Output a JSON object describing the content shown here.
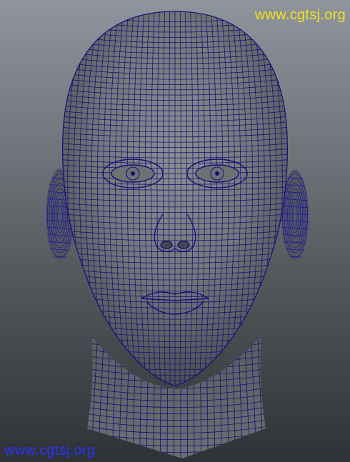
{
  "viewport": {
    "watermark_top": "www.cgtsj.org",
    "watermark_bottom": "www.cgtsj.org"
  },
  "model": {
    "icon": "wireframe-head-mesh-icon"
  },
  "colors": {
    "watermark_top": "#f2e21a",
    "watermark_bottom": "#2a31ff",
    "wire": "#10107a",
    "skin": "#7a7b7e"
  }
}
